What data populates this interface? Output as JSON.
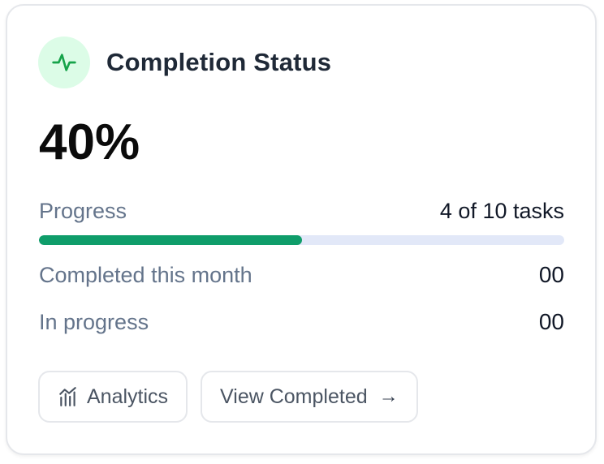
{
  "card": {
    "title": "Completion Status",
    "icon": "activity-icon",
    "percent_label": "40%",
    "accent_color": "#0f9d6a",
    "icon_bg_color": "#dcfce7"
  },
  "progress": {
    "label": "Progress",
    "value_text": "4 of 10 tasks",
    "fraction": 0.5
  },
  "stats": [
    {
      "label": "Completed this month",
      "value": "00"
    },
    {
      "label": "In progress",
      "value": "00"
    }
  ],
  "buttons": {
    "analytics": {
      "label": "Analytics",
      "icon": "bar-chart-icon"
    },
    "view_completed": {
      "label": "View Completed",
      "arrow": "→",
      "icon": "arrow-right-icon"
    }
  }
}
